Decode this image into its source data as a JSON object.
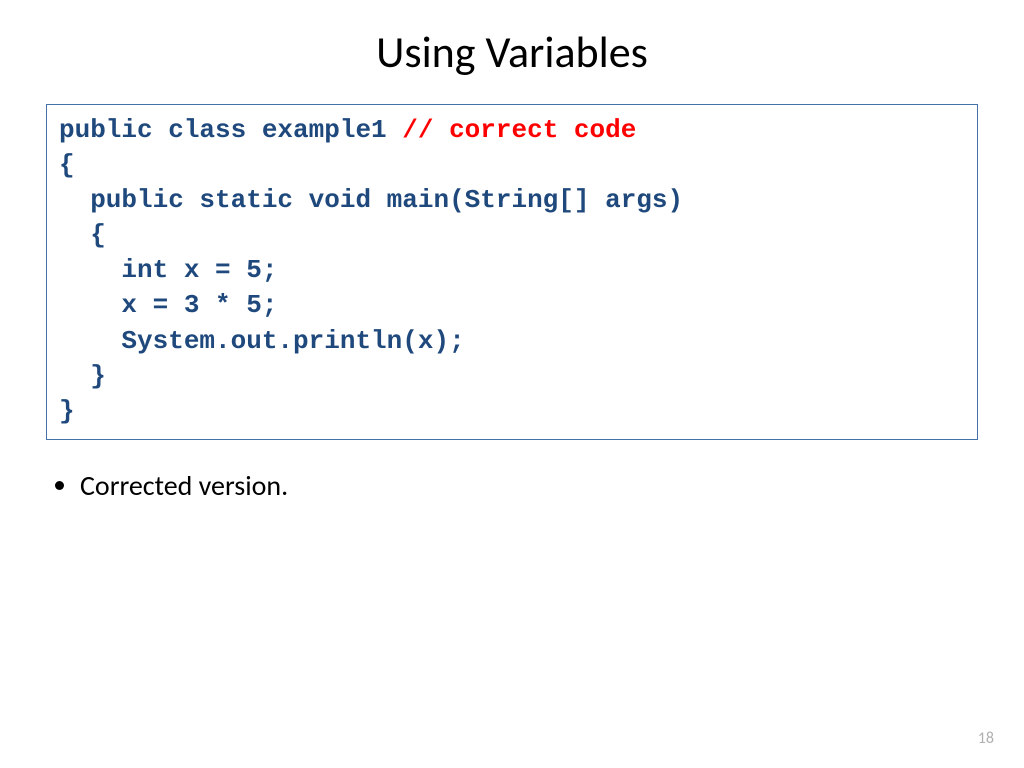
{
  "title": "Using Variables",
  "code": {
    "line1a": "public class example1 ",
    "line1b": "// correct code",
    "line2": "{",
    "line3": "  public static void main(String[] args)",
    "line4": "  {",
    "line5": "    int x = 5;",
    "line6": "    x = 3 * 5;",
    "line7": "    System.out.println(x);",
    "line8": "  }",
    "line9": "}"
  },
  "bullet1": "Corrected version.",
  "pageNumber": "18"
}
